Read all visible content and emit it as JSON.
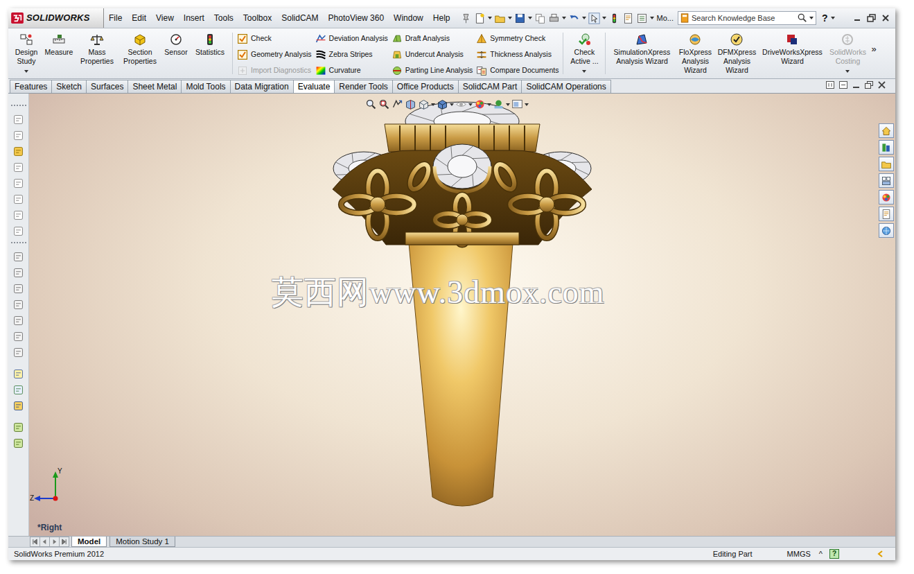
{
  "app": {
    "logo": "SOLIDWORKS"
  },
  "menu": [
    "File",
    "Edit",
    "View",
    "Insert",
    "Tools",
    "Toolbox",
    "SolidCAM",
    "PhotoView 360",
    "Window",
    "Help"
  ],
  "quick_toolbar": {
    "overflow": "Mo..."
  },
  "search": {
    "placeholder": "Search Knowledge Base"
  },
  "help_button": "?",
  "ribbon": {
    "large_left": [
      {
        "label": "Design Study",
        "has_menu": true
      },
      {
        "label": "Measure",
        "has_menu": false
      },
      {
        "label": "Mass Properties",
        "has_menu": false
      },
      {
        "label": "Section Properties",
        "has_menu": false
      },
      {
        "label": "Sensor",
        "has_menu": false
      },
      {
        "label": "Statistics",
        "has_menu": false
      }
    ],
    "columns": [
      [
        {
          "label": "Check",
          "disabled": false
        },
        {
          "label": "Geometry Analysis",
          "disabled": false
        },
        {
          "label": "Import Diagnostics",
          "disabled": true
        }
      ],
      [
        {
          "label": "Deviation Analysis",
          "disabled": false
        },
        {
          "label": "Zebra Stripes",
          "disabled": false
        },
        {
          "label": "Curvature",
          "disabled": false
        }
      ],
      [
        {
          "label": "Draft Analysis",
          "disabled": false
        },
        {
          "label": "Undercut Analysis",
          "disabled": false
        },
        {
          "label": "Parting Line Analysis",
          "disabled": false
        }
      ],
      [
        {
          "label": "Symmetry Check",
          "disabled": false
        },
        {
          "label": "Thickness Analysis",
          "disabled": false
        },
        {
          "label": "Compare Documents",
          "disabled": false
        }
      ]
    ],
    "large_right": [
      {
        "label": "Check Active ...",
        "has_menu": true,
        "disabled": false
      },
      {
        "label": "SimulationXpress Analysis Wizard",
        "has_menu": false,
        "disabled": false
      },
      {
        "label": "FloXpress Analysis Wizard",
        "has_menu": false,
        "disabled": false
      },
      {
        "label": "DFMXpress Analysis Wizard",
        "has_menu": false,
        "disabled": false
      },
      {
        "label": "DriveWorksXpress Wizard",
        "has_menu": false,
        "disabled": false
      },
      {
        "label": "SolidWorks Costing",
        "has_menu": true,
        "disabled": true
      }
    ],
    "overflow": "»"
  },
  "tabs": [
    {
      "label": "Features",
      "selected": false
    },
    {
      "label": "Sketch",
      "selected": false
    },
    {
      "label": "Surfaces",
      "selected": false
    },
    {
      "label": "Sheet Metal",
      "selected": false
    },
    {
      "label": "Mold Tools",
      "selected": false
    },
    {
      "label": "Data Migration",
      "selected": false
    },
    {
      "label": "Evaluate",
      "selected": true
    },
    {
      "label": "Render Tools",
      "selected": false
    },
    {
      "label": "Office Products",
      "selected": false
    },
    {
      "label": "SolidCAM Part",
      "selected": false
    },
    {
      "label": "SolidCAM Operations",
      "selected": false
    }
  ],
  "viewport": {
    "watermark": "莫西网www.3dmox.com",
    "view_label": "*Right",
    "axes": {
      "y": "Y",
      "z": "Z"
    }
  },
  "bottom_tabs": [
    {
      "label": "Model",
      "selected": true
    },
    {
      "label": "Motion Study 1",
      "selected": false
    }
  ],
  "status_bar": {
    "product": "SolidWorks Premium 2012",
    "mode": "Editing Part",
    "units": "MMGS",
    "units_arrow": "^",
    "help": "?"
  }
}
